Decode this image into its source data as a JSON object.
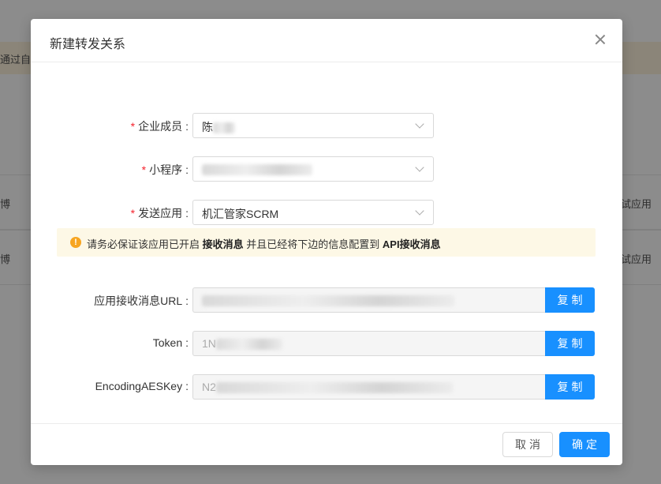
{
  "background": {
    "banner_text": "通过自动",
    "rows": [
      {
        "left": "博",
        "right": "试应用"
      },
      {
        "left": "博",
        "right": "试应用"
      }
    ]
  },
  "dialog": {
    "title": "新建转发关系",
    "fields": {
      "member": {
        "label": "企业成员",
        "required": true,
        "value": "陈"
      },
      "mini_program": {
        "label": "小程序",
        "required": true,
        "value": ""
      },
      "send_app": {
        "label": "发送应用",
        "required": true,
        "value": "机汇管家SCRM"
      }
    },
    "alert": {
      "icon": "warning-icon",
      "text_before": "请务必保证该应用已开启",
      "bold1": "接收消息",
      "text_middle": "并且已经将下边的信息配置到",
      "bold2": "API接收消息"
    },
    "config": {
      "url": {
        "label": "应用接收消息URL",
        "value": ""
      },
      "token": {
        "label": "Token",
        "value": "1N"
      },
      "aes_key": {
        "label": "EncodingAESKey",
        "value": "N2"
      },
      "copy_label": "复制"
    },
    "footer": {
      "cancel_label": "取消",
      "ok_label": "确定"
    }
  },
  "colors": {
    "primary": "#1890ff",
    "required": "#f5222d",
    "warning": "#f7a520",
    "alert_bg": "#fdf8e6"
  }
}
